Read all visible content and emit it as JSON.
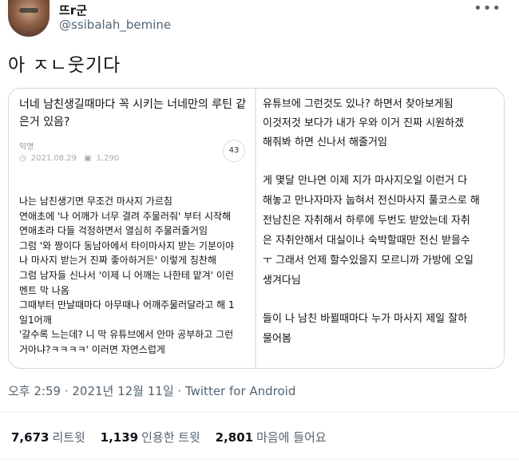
{
  "user": {
    "display_name": "뜨r군",
    "handle": "@ssibalah_bemine",
    "more_icon": "•••"
  },
  "tweet": {
    "text": "아 ㅈㄴ웃기다"
  },
  "image": {
    "left": {
      "title": "너네 남친생길때마다 꼭 시키는 너네만의 루틴 같은거 있음?",
      "author": "익명",
      "date": "2021.08.29",
      "views": "1,290",
      "comments": "43",
      "lines": [
        "나는 남친생기면 무조건 마사지 가르침",
        "연애초에 '나 어깨가 너무 결려 주물러줘' 부터 시작해",
        "연애초라 다들 걱정하면서 열심히 주물러줄거임",
        "그럼 '와 짱이다 동남아에서 타이마사지 받는 기분이야",
        "나 마사지 받는거 진짜 좋아하거든' 이렇게 칭찬해",
        "그럼 남자들 신나서 '이제 니 어깨는 나한테 맡겨' 이런",
        "멘트 막 나옴",
        "그때부터 만날때마다 아무때나 어깨주물러달라고 해 1",
        "일1어깨",
        "'갈수록 느는데? 니 막 유튜브에서 안마 공부하고 그런",
        "거아냐?ㅋㅋㅋㅋ' 이러면 자연스럽게"
      ]
    },
    "right": {
      "lines": [
        "유튜브에 그런것도 있나? 하면서 찾아보게됨",
        "이것저것 보다가 내가 우와 이거 진짜 시원하겠",
        "해줘봐 하면 신나서 해줄거임",
        "게 몇달 만나면 이제 지가 마사지오일 이런거 다",
        "해놓고 만나자마자 눕혀서 전신마사지 풀코스로 해",
        "전남친은 자취해서 하루에 두번도 받았는데 자취",
        "은 자취안해서 대실이나 숙박할때만 전신 받을수",
        "ㅜ 그래서 언제 할수있을지 모르니까 가방에 오일",
        "생겨다님",
        "들이 나 남친 바뀔때마다 누가 마사지 제일 잘하",
        "물어봄"
      ]
    }
  },
  "timestamp": "오후 2:59 · 2021년 12월 11일 · Twitter for Android",
  "stats": {
    "retweets_count": "7,673",
    "retweets_label": "리트윗",
    "quotes_count": "1,139",
    "quotes_label": "인용한 트윗",
    "likes_count": "2,801",
    "likes_label": "마음에 들어요"
  }
}
